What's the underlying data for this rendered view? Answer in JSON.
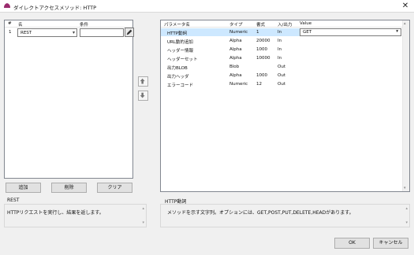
{
  "window": {
    "title": "ダイレクトアクセスメソッド: HTTP",
    "close_glyph": "✕",
    "icon": "app-logo-icon"
  },
  "left_table": {
    "columns": [
      "#",
      "名",
      "条件"
    ],
    "rows": [
      {
        "index": "1",
        "name": "REST",
        "condition": ""
      }
    ]
  },
  "right_table": {
    "columns": [
      "パラメータ名",
      "タイプ",
      "書式",
      "入/出力",
      "Value"
    ],
    "rows": [
      {
        "name": "HTTP動詞",
        "type": "Numeric",
        "format": "1",
        "io": "In",
        "value": "GET",
        "selected": true
      },
      {
        "name": "URL動的追加",
        "type": "Alpha",
        "format": "20000",
        "io": "In",
        "value": ""
      },
      {
        "name": "ヘッダー情報",
        "type": "Alpha",
        "format": "1000",
        "io": "In",
        "value": ""
      },
      {
        "name": "ヘッダーセット",
        "type": "Alpha",
        "format": "10000",
        "io": "In",
        "value": ""
      },
      {
        "name": "出力BLOB",
        "type": "Blob",
        "format": "",
        "io": "Out",
        "value": ""
      },
      {
        "name": "出力ヘッダ",
        "type": "Alpha",
        "format": "1000",
        "io": "Out",
        "value": ""
      },
      {
        "name": "エラーコード",
        "type": "Numeric",
        "format": "12",
        "io": "Out",
        "value": ""
      }
    ]
  },
  "buttons": {
    "add": "追加",
    "delete": "削除",
    "clear": "クリア",
    "ok": "OK",
    "cancel": "キャンセル"
  },
  "left_desc": {
    "label": "REST",
    "text": "HTTPリクエストを実行し、結果を返します。"
  },
  "right_desc": {
    "label": "HTTP動詞",
    "text": "メソッドを示す文字列。オプションには、GET,POST,PUT,DELETE,HEADがあります。"
  },
  "icons": {
    "move_up": "arrow-up-icon",
    "move_down": "arrow-down-icon",
    "edit": "pencil-icon"
  }
}
